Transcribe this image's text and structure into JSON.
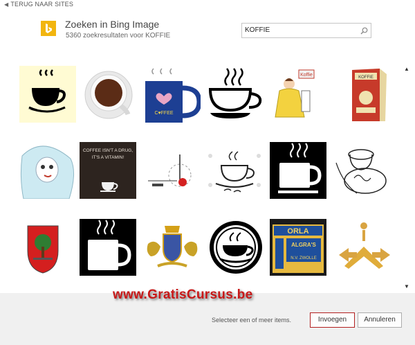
{
  "back_link": {
    "label": "TERUG NAAR SITES"
  },
  "header": {
    "title": "Zoeken in Bing Image",
    "subtitle": "5360 zoekresultaten voor KOFFIE",
    "logo_icon": "bing-logo-icon",
    "logo_color": "#f2b50f"
  },
  "search": {
    "value": "KOFFIE",
    "icon": "search-icon"
  },
  "results": [
    {
      "name": "coffee-cup-steam-clipart"
    },
    {
      "name": "coffee-cup-topview"
    },
    {
      "name": "blue-mug-heart"
    },
    {
      "name": "coffee-cup-outline"
    },
    {
      "name": "koffie-cartoon-woman"
    },
    {
      "name": "koffie-package-box"
    },
    {
      "name": "cartoon-girl"
    },
    {
      "name": "coffee-sign-dark"
    },
    {
      "name": "diagram-dial"
    },
    {
      "name": "coffee-cup-sketch"
    },
    {
      "name": "white-mug-black-bg"
    },
    {
      "name": "cups-pastry-drawing"
    },
    {
      "name": "coat-of-arms-tree"
    },
    {
      "name": "mug-icon-black"
    },
    {
      "name": "heraldic-crest"
    },
    {
      "name": "coffee-circle-emblem"
    },
    {
      "name": "orla-tin"
    },
    {
      "name": "gold-arrows-figure"
    }
  ],
  "tile_texts": {
    "koffie_sign": "Koffie",
    "pkg_top": "KOFFIE",
    "orla": "ORLA",
    "algra": "ALGRA'S",
    "zwolle": "N.V. ZWOLLE",
    "dark_line1": "COFFEE ISN'T A DRUG,",
    "dark_line2": "IT'S A VITAMIN!",
    "mug_text": "C♥FFEE"
  },
  "scrollbar": {
    "up_icon": "scroll-up-arrow-icon",
    "down_icon": "scroll-down-arrow-icon"
  },
  "watermark": "www.GratisCursus.be",
  "footer": {
    "hint": "Selecteer een of meer items.",
    "insert_label": "Invoegen",
    "cancel_label": "Annuleren"
  },
  "colors": {
    "insert_border": "#b31e1e",
    "watermark": "#c81818",
    "footer_bg": "#f0f0f0"
  }
}
